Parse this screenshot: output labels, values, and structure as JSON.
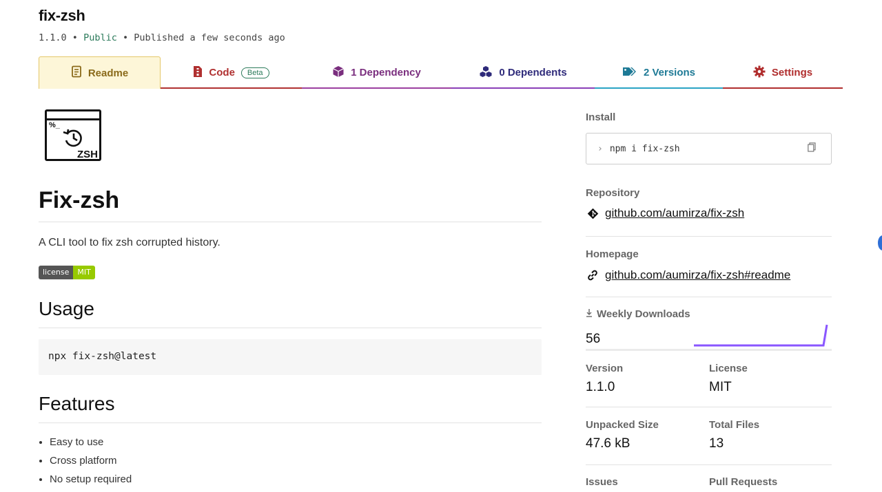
{
  "package": {
    "name": "fix-zsh",
    "version": "1.1.0",
    "sep1": "•",
    "visibility": "Public",
    "sep2": "•",
    "published": "Published a few seconds ago"
  },
  "tabs": [
    {
      "label": "Readme",
      "icon": "readme-icon"
    },
    {
      "label": "Code",
      "icon": "code-file-icon",
      "badge": "Beta"
    },
    {
      "label": "1 Dependency",
      "icon": "box-icon"
    },
    {
      "label": "0 Dependents",
      "icon": "boxes-icon"
    },
    {
      "label": "2 Versions",
      "icon": "tags-icon"
    },
    {
      "label": "Settings",
      "icon": "gear-icon"
    }
  ],
  "readme": {
    "logo_prompt": "%_",
    "logo_text": "ZSH",
    "title": "Fix-zsh",
    "description": "A CLI tool to fix zsh corrupted history.",
    "badge_left": "license",
    "badge_right": "MIT",
    "usage_heading": "Usage",
    "usage_code": "npx fix-zsh@latest",
    "features_heading": "Features",
    "features": [
      "Easy to use",
      "Cross platform",
      "No setup required"
    ]
  },
  "sidebar": {
    "install_label": "Install",
    "install_command": "npm i fix-zsh",
    "repository_label": "Repository",
    "repository_link": "github.com/aumirza/fix-zsh",
    "homepage_label": "Homepage",
    "homepage_link": "github.com/aumirza/fix-zsh#readme",
    "weekly_downloads_label": "Weekly Downloads",
    "weekly_downloads": "56",
    "stats": {
      "version_label": "Version",
      "version": "1.1.0",
      "license_label": "License",
      "license": "MIT",
      "unpacked_label": "Unpacked Size",
      "unpacked": "47.6 kB",
      "files_label": "Total Files",
      "files": "13",
      "issues_label": "Issues",
      "prs_label": "Pull Requests"
    }
  },
  "colors": {
    "readme_tab": "#e4c768",
    "code_tab": "#b03030",
    "dependency_tab": "#9b3fa0",
    "dependents_tab": "#8a3fb8",
    "versions_tab": "#29a3c4",
    "settings_tab": "#b02d2d",
    "sparkline": "#8956ff"
  }
}
